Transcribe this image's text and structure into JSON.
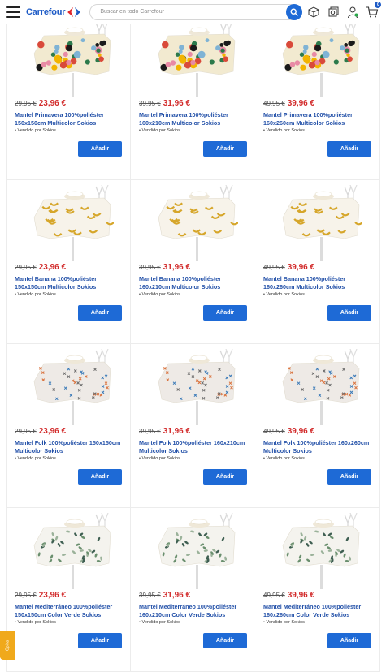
{
  "header": {
    "logo_text": "Carrefour",
    "search_placeholder": "Buscar en todo Carrefour",
    "cart_count": "0"
  },
  "colors": {
    "brand_blue": "#1e5bc6",
    "button_blue": "#1e6ad6",
    "price_red": "#d22b2b",
    "feedback_orange": "#f0a91b"
  },
  "products": [
    {
      "old_price": "29,95 €",
      "price": "23,96 €",
      "name": "Mantel Primavera 100%poliéster 150x150cm Multicolor Sokios",
      "seller": "• Vendido por Sokios",
      "add_label": "Añadir",
      "pattern": "primavera"
    },
    {
      "old_price": "39,95 €",
      "price": "31,96 €",
      "name": "Mantel Primavera 100%poliéster 160x210cm Multicolor Sokios",
      "seller": "• Vendido por Sokios",
      "add_label": "Añadir",
      "pattern": "primavera"
    },
    {
      "old_price": "49,95 €",
      "price": "39,96 €",
      "name": "Mantel Primavera 100%poliéster 160x260cm Multicolor Sokios",
      "seller": "• Vendido por Sokios",
      "add_label": "Añadir",
      "pattern": "primavera"
    },
    {
      "old_price": "29,95 €",
      "price": "23,96 €",
      "name": "Mantel Banana 100%poliéster 150x150cm Multicolor Sokios",
      "seller": "• Vendido por Sokios",
      "add_label": "Añadir",
      "pattern": "banana"
    },
    {
      "old_price": "39,95 €",
      "price": "31,96 €",
      "name": "Mantel Banana 100%poliéster 160x210cm Multicolor Sokios",
      "seller": "• Vendido por Sokios",
      "add_label": "Añadir",
      "pattern": "banana"
    },
    {
      "old_price": "49,95 €",
      "price": "39,96 €",
      "name": "Mantel Banana 100%poliéster 160x260cm Multicolor Sokios",
      "seller": "• Vendido por Sokios",
      "add_label": "Añadir",
      "pattern": "banana"
    },
    {
      "old_price": "29,95 €",
      "price": "23,96 €",
      "name": "Mantel Folk 100%poliéster 150x150cm Multicolor Sokios",
      "seller": "• Vendido por Sokios",
      "add_label": "Añadir",
      "pattern": "folk"
    },
    {
      "old_price": "39,95 €",
      "price": "31,96 €",
      "name": "Mantel Folk 100%poliéster 160x210cm Multicolor Sokios",
      "seller": "• Vendido por Sokios",
      "add_label": "Añadir",
      "pattern": "folk"
    },
    {
      "old_price": "49,95 €",
      "price": "39,96 €",
      "name": "Mantel Folk 100%poliéster 160x260cm Multicolor Sokios",
      "seller": "• Vendido por Sokios",
      "add_label": "Añadir",
      "pattern": "folk"
    },
    {
      "old_price": "29,95 €",
      "price": "23,96 €",
      "name": "Mantel Mediterráneo 100%poliéster 150x150cm Color Verde Sokios",
      "seller": "• Vendido por Sokios",
      "add_label": "Añadir",
      "pattern": "mediterraneo"
    },
    {
      "old_price": "39,95 €",
      "price": "31,96 €",
      "name": "Mantel Mediterráneo 100%poliéster 160x210cm Color Verde Sokios",
      "seller": "• Vendido por Sokios",
      "add_label": "Añadir",
      "pattern": "mediterraneo"
    },
    {
      "old_price": "49,95 €",
      "price": "39,96 €",
      "name": "Mantel Mediterráneo 100%poliéster 160x260cm Color Verde Sokios",
      "seller": "• Vendido por Sokios",
      "add_label": "Añadir",
      "pattern": "mediterraneo"
    }
  ],
  "feedback_tab": {
    "label": "Opina"
  }
}
